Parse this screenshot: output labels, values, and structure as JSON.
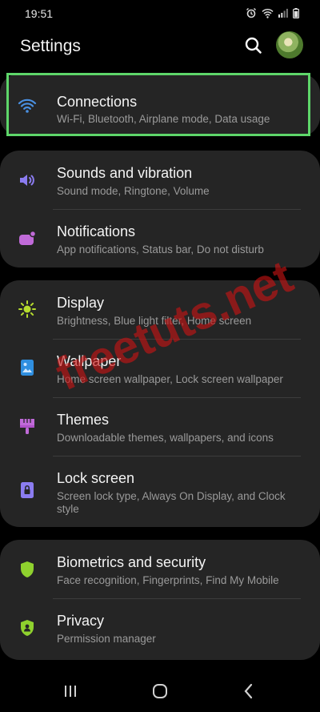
{
  "status": {
    "time": "19:51"
  },
  "header": {
    "title": "Settings"
  },
  "cards": [
    [
      {
        "title": "Connections",
        "subtitle": "Wi-Fi, Bluetooth, Airplane mode, Data usage",
        "icon": "wifi-icon"
      }
    ],
    [
      {
        "title": "Sounds and vibration",
        "subtitle": "Sound mode, Ringtone, Volume",
        "icon": "volume-icon"
      },
      {
        "title": "Notifications",
        "subtitle": "App notifications, Status bar, Do not disturb",
        "icon": "notification-icon"
      }
    ],
    [
      {
        "title": "Display",
        "subtitle": "Brightness, Blue light filter, Home screen",
        "icon": "brightness-icon"
      },
      {
        "title": "Wallpaper",
        "subtitle": "Home screen wallpaper, Lock screen wallpaper",
        "icon": "wallpaper-icon"
      },
      {
        "title": "Themes",
        "subtitle": "Downloadable themes, wallpapers, and icons",
        "icon": "themes-icon"
      },
      {
        "title": "Lock screen",
        "subtitle": "Screen lock type, Always On Display, and Clock style",
        "icon": "lock-icon"
      }
    ],
    [
      {
        "title": "Biometrics and security",
        "subtitle": "Face recognition, Fingerprints, Find My Mobile",
        "icon": "shield-icon"
      },
      {
        "title": "Privacy",
        "subtitle": "Permission manager",
        "icon": "privacy-shield-icon"
      }
    ]
  ],
  "watermark": "freetuts.net",
  "colors": {
    "accent": "#5ed66a",
    "card": "#252525",
    "wifi": "#4a90e2",
    "sound": "#8b7cf0",
    "notif": "#c06ad8",
    "display": "#b6dc2e",
    "wallpaper": "#2f8fe0",
    "themes": "#c06ad8",
    "lock": "#8b7cf0",
    "security": "#8fd12e"
  }
}
